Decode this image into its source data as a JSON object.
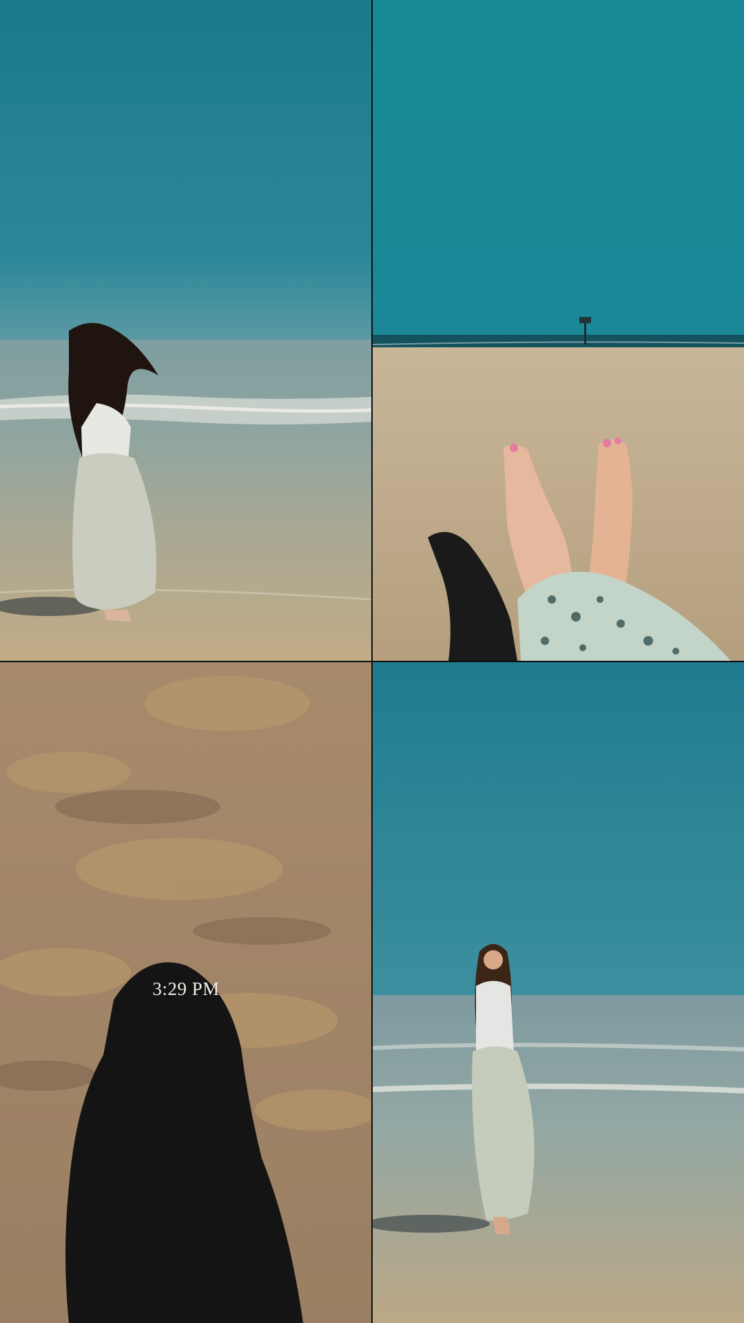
{
  "collage": {
    "panels": [
      {
        "name": "woman-walking-into-waves"
      },
      {
        "name": "bare-feet-on-sand"
      },
      {
        "name": "shadow-on-wet-sand"
      },
      {
        "name": "woman-standing-in-shallow-water"
      }
    ],
    "timestamp_text": "3:29 PM"
  },
  "colors": {
    "sky": "#1f8592",
    "sea": "#7e9da0",
    "sand": "#b8a489",
    "shadow": "#141414"
  }
}
